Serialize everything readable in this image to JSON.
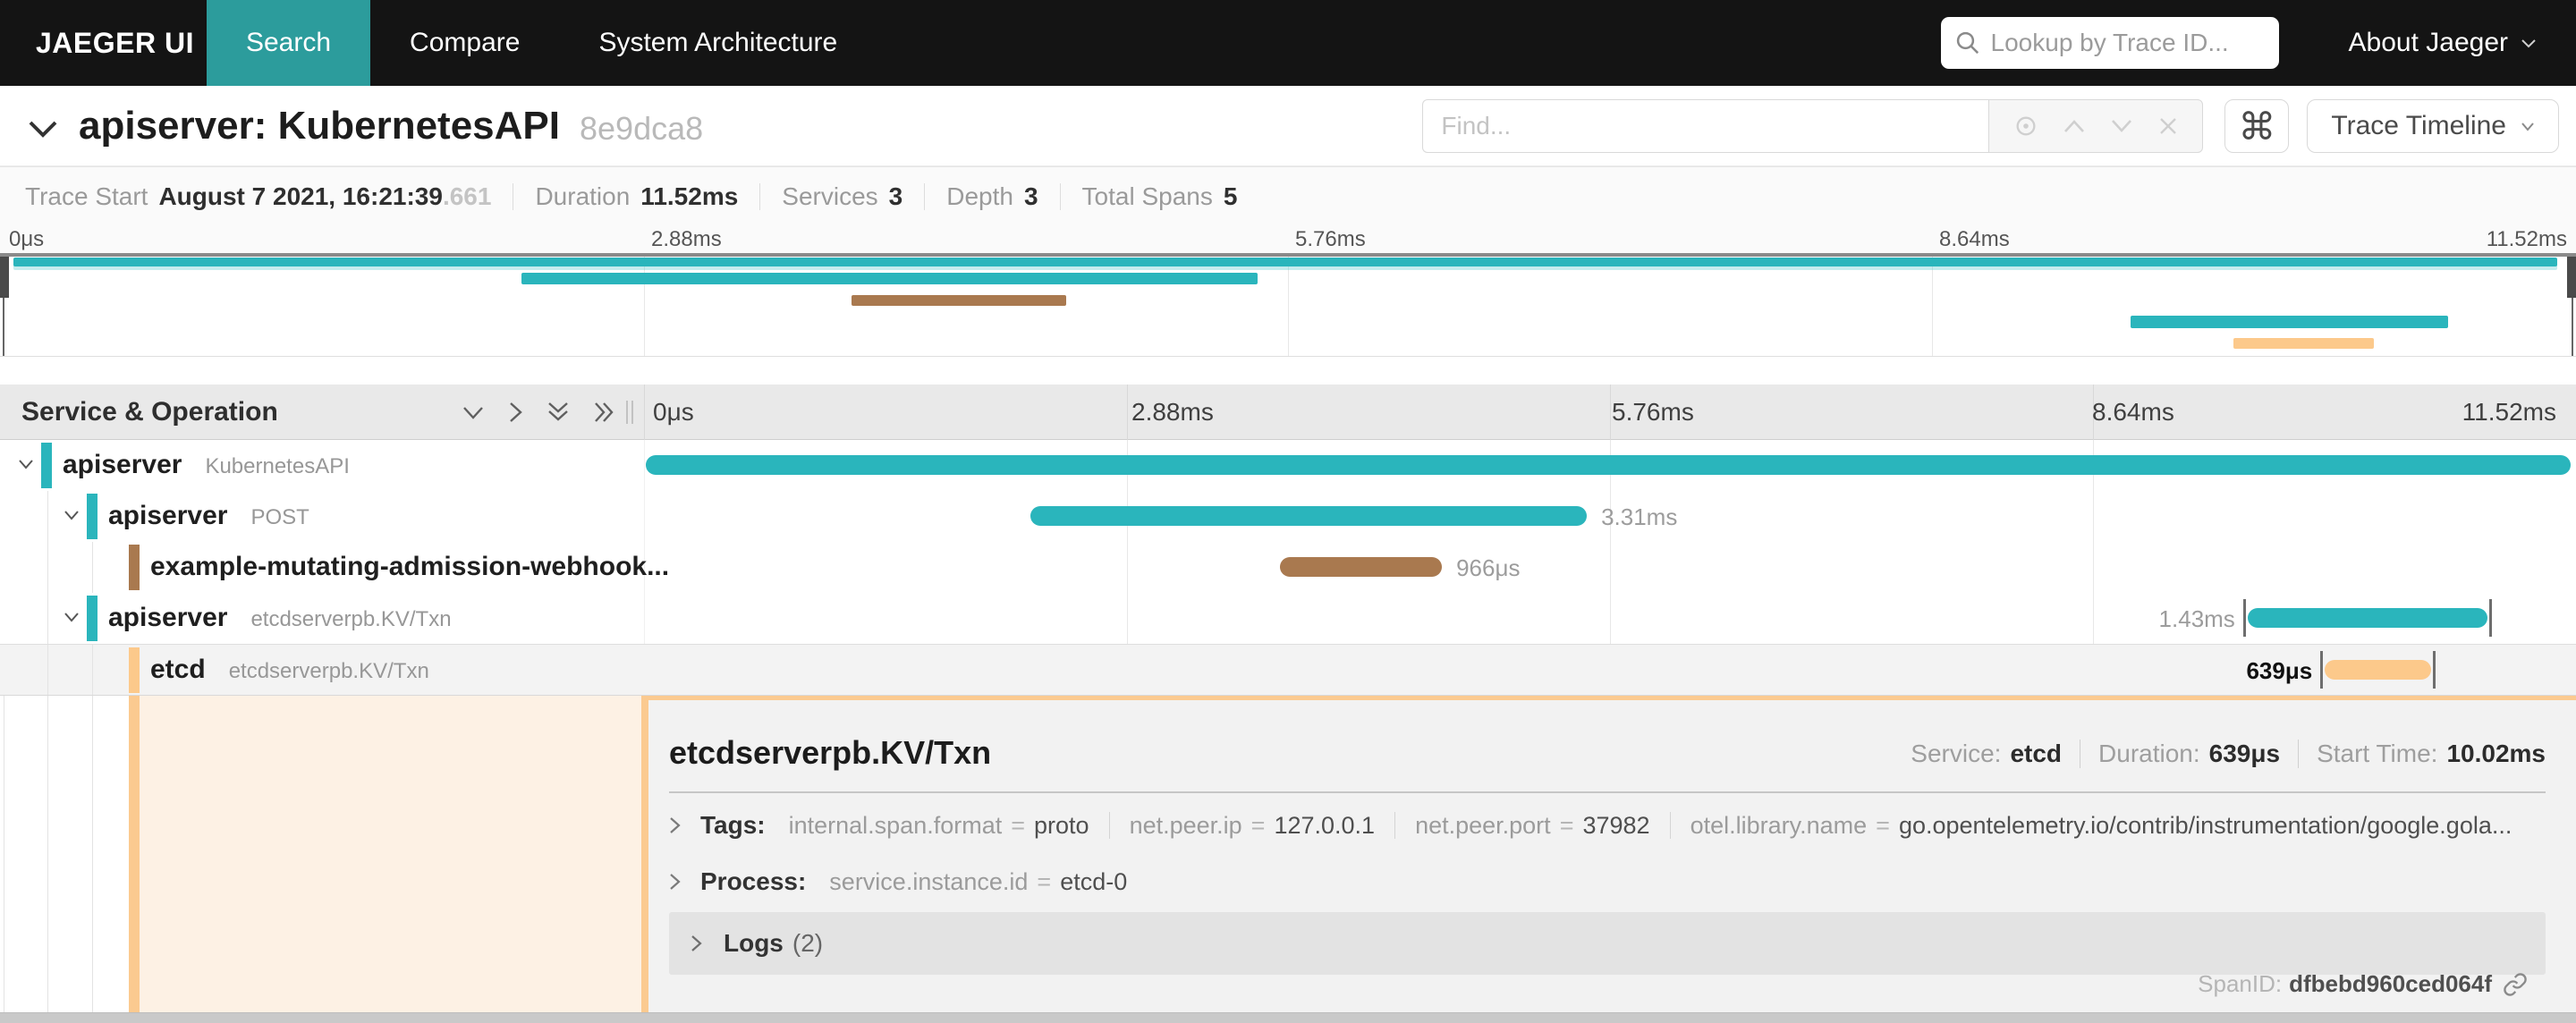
{
  "nav": {
    "brand": "JAEGER UI",
    "tabs": [
      {
        "label": "Search",
        "active": true
      },
      {
        "label": "Compare",
        "active": false
      },
      {
        "label": "System Architecture",
        "active": false
      }
    ],
    "lookup_placeholder": "Lookup by Trace ID...",
    "about_label": "About Jaeger"
  },
  "trace_header": {
    "title": "apiserver: KubernetesAPI",
    "trace_id": "8e9dca8",
    "find_placeholder": "Find...",
    "command_glyph": "⌘",
    "view_selector": "Trace Timeline"
  },
  "summary": [
    {
      "label": "Trace Start",
      "value": "August 7 2021, 16:21:39",
      "suffix": ".661"
    },
    {
      "label": "Duration",
      "value": "11.52ms",
      "suffix": ""
    },
    {
      "label": "Services",
      "value": "3",
      "suffix": ""
    },
    {
      "label": "Depth",
      "value": "3",
      "suffix": ""
    },
    {
      "label": "Total Spans",
      "value": "5",
      "suffix": ""
    }
  ],
  "timeline": {
    "ticks": [
      "0μs",
      "2.88ms",
      "5.76ms",
      "8.64ms",
      "11.52ms"
    ],
    "header_title": "Service & Operation",
    "colors": {
      "teal": "#2ab5bc",
      "brown": "#a9794f",
      "peach": "#fcc98b"
    }
  },
  "spans": [
    {
      "service": "apiserver",
      "operation": "KubernetesAPI",
      "depth": 0,
      "has_children": true,
      "color": "#2ab5bc",
      "start_pct": 0.1,
      "end_pct": 99.7,
      "duration_label": "",
      "label_side": "none",
      "selected": false,
      "end_marks": false
    },
    {
      "service": "apiserver",
      "operation": "POST",
      "depth": 1,
      "has_children": true,
      "color": "#2ab5bc",
      "start_pct": 20.0,
      "end_pct": 48.8,
      "duration_label": "3.31ms",
      "label_side": "right",
      "selected": false,
      "end_marks": false
    },
    {
      "service": "example-mutating-admission-webhook...",
      "operation": "",
      "depth": 2,
      "has_children": false,
      "color": "#a9794f",
      "start_pct": 32.9,
      "end_pct": 41.3,
      "duration_label": "966μs",
      "label_side": "right",
      "selected": false,
      "end_marks": false
    },
    {
      "service": "apiserver",
      "operation": "etcdserverpb.KV/Txn",
      "depth": 1,
      "has_children": true,
      "color": "#2ab5bc",
      "start_pct": 83.0,
      "end_pct": 95.4,
      "duration_label": "1.43ms",
      "label_side": "left",
      "selected": false,
      "end_marks": true
    },
    {
      "service": "etcd",
      "operation": "etcdserverpb.KV/Txn",
      "depth": 2,
      "has_children": false,
      "color": "#fcc98b",
      "start_pct": 87.0,
      "end_pct": 92.5,
      "duration_label": "639μs",
      "label_side": "left",
      "selected": true,
      "end_marks": true
    }
  ],
  "detail": {
    "title": "etcdserverpb.KV/Txn",
    "meta": [
      {
        "label": "Service:",
        "value": "etcd"
      },
      {
        "label": "Duration:",
        "value": "639μs"
      },
      {
        "label": "Start Time:",
        "value": "10.02ms"
      }
    ],
    "tags": {
      "label": "Tags:",
      "items": [
        {
          "key": "internal.span.format",
          "value": "proto"
        },
        {
          "key": "net.peer.ip",
          "value": "127.0.0.1"
        },
        {
          "key": "net.peer.port",
          "value": "37982"
        },
        {
          "key": "otel.library.name",
          "value": "go.opentelemetry.io/contrib/instrumentation/google.gola..."
        }
      ]
    },
    "process": {
      "label": "Process:",
      "items": [
        {
          "key": "service.instance.id",
          "value": "etcd-0"
        }
      ]
    },
    "logs": {
      "label": "Logs",
      "count": "(2)"
    },
    "span_id": {
      "label": "SpanID:",
      "value": "dfbebd960ced064f"
    }
  }
}
